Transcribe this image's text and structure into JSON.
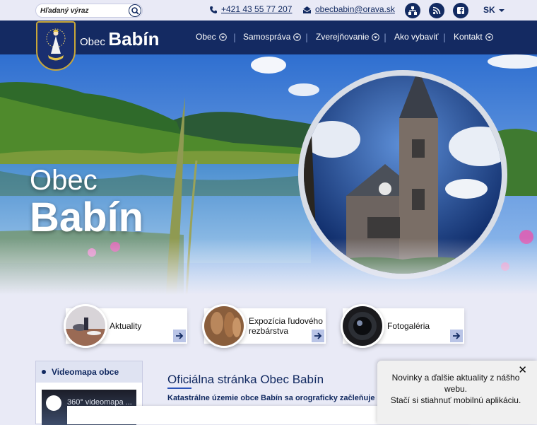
{
  "topbar": {
    "search_placeholder": "Hľadaný výraz",
    "phone": "+421 43 55 77 207",
    "email": "obecbabin@orava.sk",
    "lang": "SK"
  },
  "brand": {
    "small": "Obec",
    "big": "Babín"
  },
  "nav": [
    {
      "label": "Obec",
      "has_menu": true
    },
    {
      "label": "Samospráva",
      "has_menu": true
    },
    {
      "label": "Zverejňovanie",
      "has_menu": true
    },
    {
      "label": "Ako vybaviť",
      "has_menu": false
    },
    {
      "label": "Kontakt",
      "has_menu": true
    }
  ],
  "hero": {
    "line1": "Obec",
    "line2": "Babín"
  },
  "cards": [
    {
      "label": "Aktuality"
    },
    {
      "label_line1": "Expozícia ľudového",
      "label_line2": "rezbárstva"
    },
    {
      "label": "Fotogaléria"
    }
  ],
  "video": {
    "heading": "Videomapa obce",
    "thumb_label": "360° videomapa ..."
  },
  "main": {
    "title": "Oficiálna stránka Obec Babín",
    "text": "Katastrálne územie obce Babín sa orograficky začleňuje do"
  },
  "toast": {
    "line1": "Novinky a ďalšie aktuality z nášho",
    "line2": "webu.",
    "line3": "Stačí si stiahnuť mobilnú aplikáciu."
  },
  "colors": {
    "navy": "#142a62",
    "accent": "#2a52b8",
    "page_bg": "#e9eaf6"
  }
}
